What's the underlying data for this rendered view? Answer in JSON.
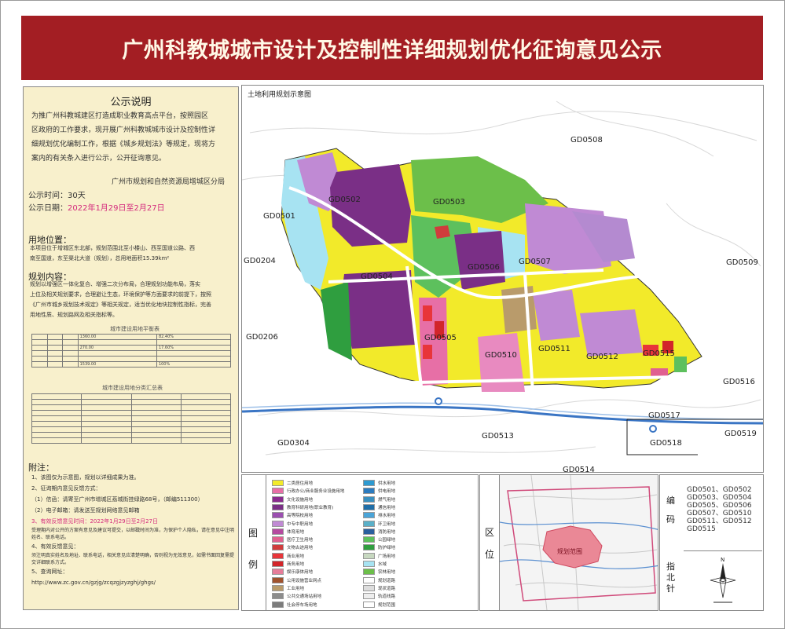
{
  "banner": {
    "title": "广州科教城城市设计及控制性详细规划优化征询意见公示"
  },
  "notice": {
    "heading": "公示说明",
    "intro": [
      "为推广州科教城建区打造成职业教育高点平台，按照园区",
      "区政府的工作要求，现开展广州科教城城市设计及控制性详",
      "细规划优化编制工作，根据《城乡规划法》等规定，现将方",
      "案内的有关条入进行公示，公开征询意见。"
    ],
    "issuer": "广州市规划和自然资源局增城区分局",
    "period_label": "公示时间：",
    "period_value": "30天",
    "date_label": "公示日期：",
    "date_value": "2022年1月29日至2月27日",
    "location_heading": "用地位置：",
    "location_text": [
      "本项目位于增城区东北部，规划范围北至小楼山、西至国道公路、西",
      "南至国道，东至渠北大道（规划），总用地面积15.39km²"
    ],
    "content_heading": "规划内容：",
    "content_text": [
      "规划以增强区一体化复合、增强二次分布局，合理规划功能布局，落实",
      "上位及相关规划要求，合理避让生态，环境保护等方面要求的前提下，按照",
      "《广州市城乡规划技术规定》等相关规定，适当优化地块控制性指标，完善",
      "用地性质、规划路网及相关指标等。"
    ],
    "table1_title": "城市建设用地平衡表",
    "table2_title": "城市建设用地分类汇总表",
    "appendix_heading": "附注：",
    "appendix_items": [
      "1、该图仅为示意图，规划以详细成果为准。",
      "2、征询期内意见反馈方式：",
      "（1）信函：请寄至广州市增城区荔城街挂绿路68号，（邮编511300）",
      "（2）电子邮箱：请发送至规划网络意见邮箱",
      "3、有效反馈意见时间：2022年1月29日至2月27日",
      "受理期内对公开的方案有意见及建议可提交，以邮戳时间为准，为保护个人隐私，请在意见中注明姓名、联系电话。",
      "4、有效反馈意见：",
      "须注明真实姓名及地址、联系电话，相关意见应清楚明确，否则视为无效意见，如需书面回复需提交详细联系方式。",
      "5、查询网址：",
      "http://www.zc.gov.cn/gzjg/zcqzgjzyzghj/ghgs/"
    ],
    "table1_rows": [
      [
        "",
        "",
        "",
        "1360.00",
        "82.40%"
      ],
      [
        "",
        "",
        "",
        "",
        ""
      ],
      [
        "",
        "",
        "",
        "270.00",
        "17.60%"
      ],
      [
        "",
        "",
        "",
        "",
        ""
      ],
      [
        "",
        "",
        "",
        "",
        ""
      ],
      [
        "",
        "",
        "",
        "1539.00",
        "100%"
      ]
    ],
    "table2_rows": [
      [
        "",
        "",
        "",
        ""
      ],
      [
        "",
        "",
        "",
        ""
      ],
      [
        "",
        "",
        "",
        ""
      ],
      [
        "",
        "",
        "",
        ""
      ],
      [
        "",
        "",
        "",
        ""
      ],
      [
        "",
        "",
        "",
        ""
      ],
      [
        "",
        "",
        "",
        ""
      ],
      [
        "",
        "",
        "",
        ""
      ],
      [
        "",
        "",
        "",
        ""
      ]
    ]
  },
  "map": {
    "caption": "土地利用规划示意图",
    "labels": [
      "GD0508",
      "GD0502",
      "GD0503",
      "GD0501",
      "GD0204",
      "GD0509",
      "GD0507",
      "GD0506",
      "GD0504",
      "GD0206",
      "GD0505",
      "GD0511",
      "GD0510",
      "GD0512",
      "GD0515",
      "GD0516",
      "GD0517",
      "GD0519",
      "GD0518",
      "GD0513",
      "GD0304",
      "GD0514"
    ]
  },
  "legend": {
    "side_top": "图",
    "side_bottom": "例",
    "items": [
      {
        "label": "二类居住用地",
        "color": "#f2ea2a"
      },
      {
        "label": "行政办公/商业服务业设施用地",
        "color": "#e76fa6"
      },
      {
        "label": "文化设施用地",
        "color": "#8a2a8e"
      },
      {
        "label": "教育科研用地(职业教育)",
        "color": "#7a2f86"
      },
      {
        "label": "高等院校用地",
        "color": "#9b4fb0"
      },
      {
        "label": "中专中职用地",
        "color": "#c08ad4"
      },
      {
        "label": "体育用地",
        "color": "#b54aa0"
      },
      {
        "label": "医疗卫生用地",
        "color": "#e06090"
      },
      {
        "label": "文物古迹用地",
        "color": "#d03c3c"
      },
      {
        "label": "商业用地",
        "color": "#e8353a"
      },
      {
        "label": "商务用地",
        "color": "#d2252a"
      },
      {
        "label": "娱乐康体用地",
        "color": "#e67d9a"
      },
      {
        "label": "公用设施营业网点",
        "color": "#a0522d"
      },
      {
        "label": "工业用地",
        "color": "#b99b6b"
      },
      {
        "label": "公共交通场站用地",
        "color": "#8c8c8c"
      },
      {
        "label": "社会停车场用地",
        "color": "#7c7c7c"
      },
      {
        "label": "供水用地",
        "color": "#2e9ad0"
      },
      {
        "label": "供电用地",
        "color": "#2c7bbf"
      },
      {
        "label": "燃气用地",
        "color": "#3a90c0"
      },
      {
        "label": "通信用地",
        "color": "#1f6ea8"
      },
      {
        "label": "排水用地",
        "color": "#4aa4d8"
      },
      {
        "label": "环卫用地",
        "color": "#5ab0c8"
      },
      {
        "label": "消防用地",
        "color": "#2a5f9e"
      },
      {
        "label": "公园绿地",
        "color": "#5dc05d"
      },
      {
        "label": "防护绿地",
        "color": "#2f9e3f"
      },
      {
        "label": "广场用地",
        "color": "#c7d8c0"
      },
      {
        "label": "水域",
        "color": "#a7e3f2"
      },
      {
        "label": "农林用地",
        "color": "#6cbf4a"
      },
      {
        "label": "规划道路",
        "color": "#ffffff"
      },
      {
        "label": "现状道路",
        "color": "#dddddd"
      },
      {
        "label": "轨道线路",
        "color": "#eeeeee"
      },
      {
        "label": "规划范围",
        "color": "#ffffff"
      }
    ]
  },
  "location": {
    "side_top": "区",
    "side_bottom": "位",
    "area_label": "规划范围"
  },
  "codes": {
    "side_top": "编",
    "side_bottom": "码",
    "north_top": "指",
    "north_mid": "北",
    "north_bottom": "针",
    "list": [
      "GD0501、GD0502",
      "GD0503、GD0504",
      "GD0505、GD0506",
      "GD0507、GD0510",
      "GD0511、GD0512",
      "GD0515"
    ]
  },
  "colors": {
    "banner": "#a31e23",
    "notice_bg": "#f8f0cc",
    "residential": "#f2ea2a",
    "education": "#7a2f86",
    "college": "#c08ad4",
    "green": "#5dc05d",
    "water": "#a7e3f2",
    "commercial": "#e76fa6"
  }
}
